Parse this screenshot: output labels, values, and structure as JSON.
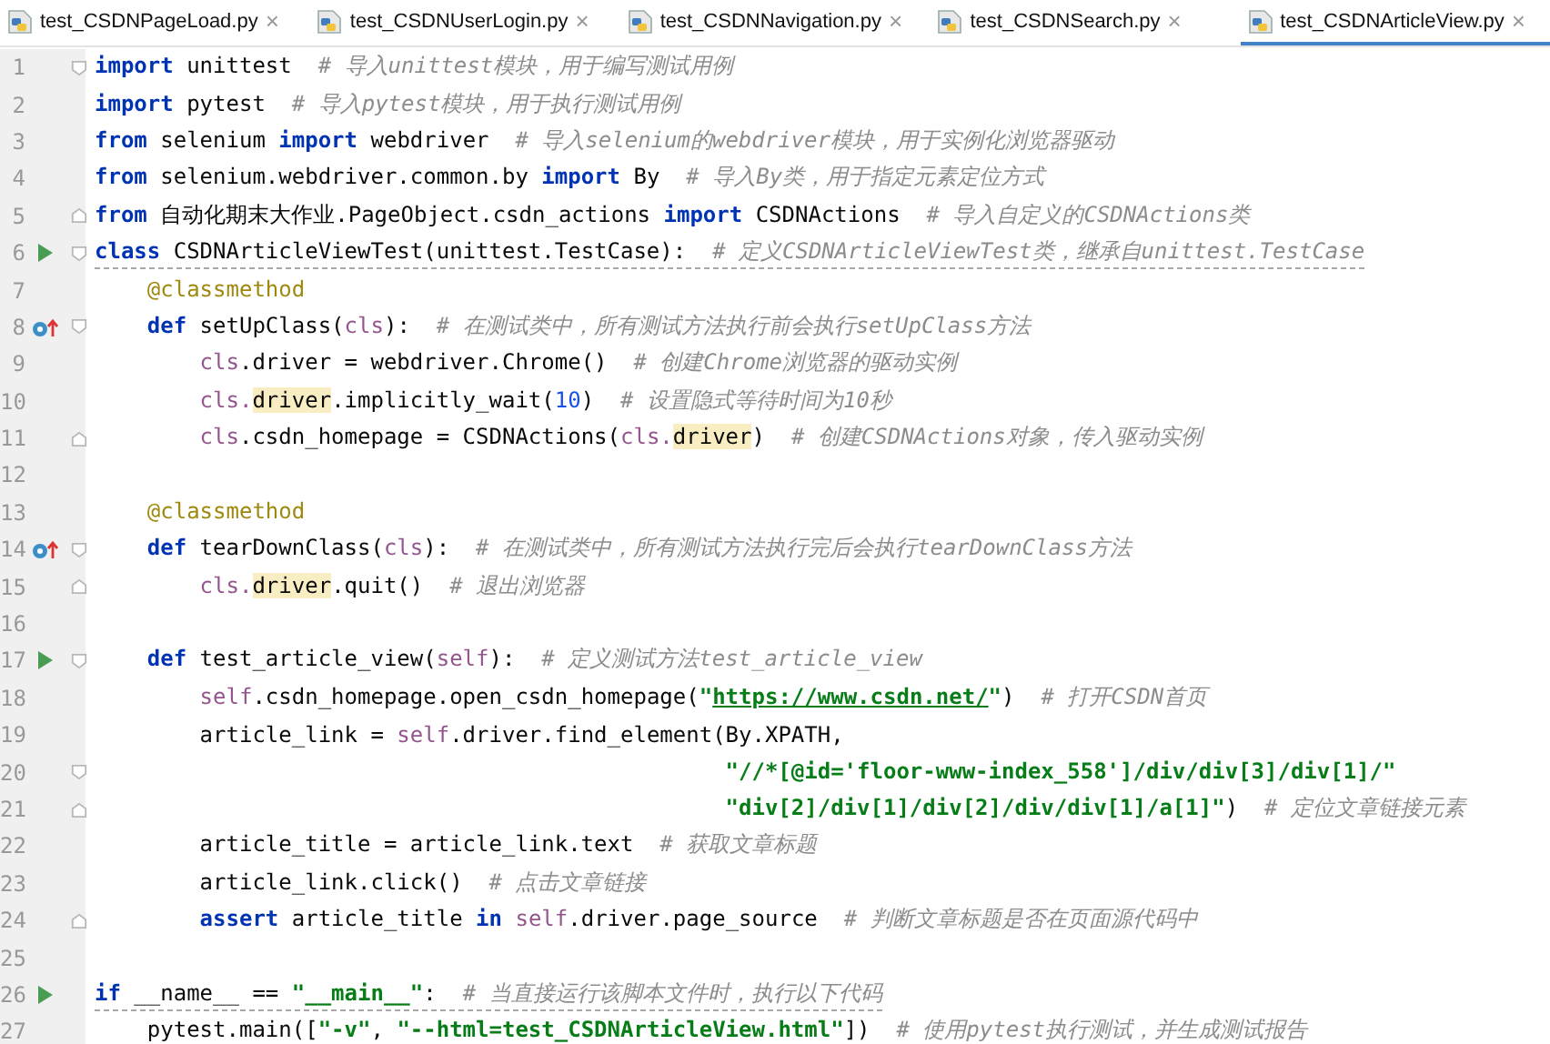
{
  "tabs": [
    {
      "label": "test_CSDNPageLoad.py",
      "close": "×",
      "selected": false
    },
    {
      "label": "test_CSDNUserLogin.py",
      "close": "×",
      "selected": false
    },
    {
      "label": "test_CSDNNavigation.py",
      "close": "×",
      "selected": false
    },
    {
      "label": "test_CSDNSearch.py",
      "close": "×",
      "selected": false
    },
    {
      "label": "test_CSDNArticleView.py",
      "close": "×",
      "selected": true
    }
  ],
  "lines": [
    {
      "number": "1",
      "fold": {
        "kind": "open"
      },
      "warning": false,
      "tokens": [
        {
          "kind": "kw",
          "text": "import"
        },
        {
          "kind": "p",
          "text": " unittest  "
        },
        {
          "kind": "c",
          "text": "# 导入unittest模块，用于编写测试用例"
        }
      ]
    },
    {
      "number": "2",
      "warning": false,
      "tokens": [
        {
          "kind": "kw",
          "text": "import"
        },
        {
          "kind": "p",
          "text": " pytest  "
        },
        {
          "kind": "c",
          "text": "# 导入pytest模块，用于执行测试用例"
        }
      ]
    },
    {
      "number": "3",
      "warning": false,
      "tokens": [
        {
          "kind": "kw",
          "text": "from"
        },
        {
          "kind": "p",
          "text": " selenium "
        },
        {
          "kind": "kw",
          "text": "import"
        },
        {
          "kind": "p",
          "text": " webdriver  "
        },
        {
          "kind": "c",
          "text": "# 导入selenium的webdriver模块，用于实例化浏览器驱动"
        }
      ]
    },
    {
      "number": "4",
      "warning": false,
      "tokens": [
        {
          "kind": "kw",
          "text": "from"
        },
        {
          "kind": "p",
          "text": " selenium.webdriver.common.by "
        },
        {
          "kind": "kw",
          "text": "import"
        },
        {
          "kind": "p",
          "text": " By  "
        },
        {
          "kind": "c",
          "text": "# 导入By类，用于指定元素定位方式"
        }
      ]
    },
    {
      "number": "5",
      "fold": {
        "kind": "close"
      },
      "warning": false,
      "tokens": [
        {
          "kind": "kw",
          "text": "from"
        },
        {
          "kind": "p",
          "text": " 自动化期末大作业.PageObject.csdn_actions "
        },
        {
          "kind": "kw",
          "text": "import"
        },
        {
          "kind": "p",
          "text": " CSDNActions  "
        },
        {
          "kind": "c",
          "text": "# 导入自定义的CSDNActions类"
        }
      ]
    },
    {
      "number": "6",
      "marker": {
        "kind": "run"
      },
      "fold": {
        "kind": "open"
      },
      "warning": true,
      "tokens": [
        {
          "kind": "kw",
          "text": "class"
        },
        {
          "kind": "p",
          "text": " CSDNArticleViewTest(unittest.TestCase):  "
        },
        {
          "kind": "c",
          "text": "# 定义CSDNArticleViewTest类，继承自unittest.TestCase"
        }
      ]
    },
    {
      "number": "7",
      "warning": false,
      "tokens": [
        {
          "kind": "d",
          "text": "    @classmethod"
        }
      ]
    },
    {
      "number": "8",
      "marker": {
        "kind": "override"
      },
      "fold": {
        "kind": "open"
      },
      "warning": false,
      "tokens": [
        {
          "kind": "kw",
          "text": "    def"
        },
        {
          "kind": "p",
          "text": " setUpClass("
        },
        {
          "kind": "s",
          "text": "cls"
        },
        {
          "kind": "p",
          "text": "):  "
        },
        {
          "kind": "c",
          "text": "# 在测试类中，所有测试方法执行前会执行setUpClass方法"
        }
      ]
    },
    {
      "number": "9",
      "warning": false,
      "tokens": [
        {
          "kind": "s",
          "text": "        cls"
        },
        {
          "kind": "p",
          "text": ".driver = webdriver.Chrome()  "
        },
        {
          "kind": "c",
          "text": "# 创建Chrome浏览器的驱动实例"
        }
      ]
    },
    {
      "number": "10",
      "warning": false,
      "tokens": [
        {
          "kind": "s",
          "text": "        cls."
        },
        {
          "kind": "h",
          "text": "driver"
        },
        {
          "kind": "p",
          "text": ".implicitly_wait("
        },
        {
          "kind": "n",
          "text": "10"
        },
        {
          "kind": "p",
          "text": ")  "
        },
        {
          "kind": "c",
          "text": "# 设置隐式等待时间为10秒"
        }
      ]
    },
    {
      "number": "11",
      "fold": {
        "kind": "close"
      },
      "warning": false,
      "tokens": [
        {
          "kind": "s",
          "text": "        cls"
        },
        {
          "kind": "p",
          "text": ".csdn_homepage = CSDNActions("
        },
        {
          "kind": "s",
          "text": "cls."
        },
        {
          "kind": "h",
          "text": "driver"
        },
        {
          "kind": "p",
          "text": ")  "
        },
        {
          "kind": "c",
          "text": "# 创建CSDNActions对象，传入驱动实例"
        }
      ]
    },
    {
      "number": "12",
      "warning": false
    },
    {
      "number": "13",
      "warning": false,
      "tokens": [
        {
          "kind": "d",
          "text": "    @classmethod"
        }
      ]
    },
    {
      "number": "14",
      "marker": {
        "kind": "override"
      },
      "fold": {
        "kind": "open"
      },
      "warning": false,
      "tokens": [
        {
          "kind": "kw",
          "text": "    def"
        },
        {
          "kind": "p",
          "text": " tearDownClass("
        },
        {
          "kind": "s",
          "text": "cls"
        },
        {
          "kind": "p",
          "text": "):  "
        },
        {
          "kind": "c",
          "text": "# 在测试类中，所有测试方法执行完后会执行tearDownClass方法"
        }
      ]
    },
    {
      "number": "15",
      "fold": {
        "kind": "close"
      },
      "warning": false,
      "tokens": [
        {
          "kind": "s",
          "text": "        cls."
        },
        {
          "kind": "h",
          "text": "driver"
        },
        {
          "kind": "p",
          "text": ".quit()  "
        },
        {
          "kind": "c",
          "text": "# 退出浏览器"
        }
      ]
    },
    {
      "number": "16",
      "warning": false
    },
    {
      "number": "17",
      "marker": {
        "kind": "run"
      },
      "fold": {
        "kind": "open"
      },
      "warning": false,
      "tokens": [
        {
          "kind": "kw",
          "text": "    def"
        },
        {
          "kind": "p",
          "text": " test_article_view("
        },
        {
          "kind": "s",
          "text": "self"
        },
        {
          "kind": "p",
          "text": "):  "
        },
        {
          "kind": "c",
          "text": "# 定义测试方法test_article_view"
        }
      ]
    },
    {
      "number": "18",
      "warning": false,
      "tokens": [
        {
          "kind": "s",
          "text": "        self"
        },
        {
          "kind": "p",
          "text": ".csdn_homepage.open_csdn_homepage("
        },
        {
          "kind": "str",
          "text": "\""
        },
        {
          "kind": "u",
          "text": "https://www.csdn.net/"
        },
        {
          "kind": "str",
          "text": "\""
        },
        {
          "kind": "p",
          "text": ")  "
        },
        {
          "kind": "c",
          "text": "# 打开CSDN首页"
        }
      ]
    },
    {
      "number": "19",
      "warning": false,
      "tokens": [
        {
          "kind": "p",
          "text": "        article_link = "
        },
        {
          "kind": "s",
          "text": "self"
        },
        {
          "kind": "p",
          "text": ".driver.find_element(By.XPATH,"
        }
      ]
    },
    {
      "number": "20",
      "fold": {
        "kind": "open"
      },
      "warning": false,
      "tokens": [
        {
          "kind": "str",
          "text": "                                                \"//*[@id='floor-www-index_558']/div/div[3]/div[1]/\""
        }
      ]
    },
    {
      "number": "21",
      "fold": {
        "kind": "close"
      },
      "warning": false,
      "tokens": [
        {
          "kind": "str",
          "text": "                                                \"div[2]/div[1]/div[2]/div/div[1]/a[1]\""
        },
        {
          "kind": "p",
          "text": ")  "
        },
        {
          "kind": "c",
          "text": "# 定位文章链接元素"
        }
      ]
    },
    {
      "number": "22",
      "warning": false,
      "tokens": [
        {
          "kind": "p",
          "text": "        article_title = article_link.text  "
        },
        {
          "kind": "c",
          "text": "# 获取文章标题"
        }
      ]
    },
    {
      "number": "23",
      "warning": false,
      "tokens": [
        {
          "kind": "p",
          "text": "        article_link.click()  "
        },
        {
          "kind": "c",
          "text": "# 点击文章链接"
        }
      ]
    },
    {
      "number": "24",
      "fold": {
        "kind": "close"
      },
      "warning": false,
      "tokens": [
        {
          "kind": "kw",
          "text": "        assert"
        },
        {
          "kind": "p",
          "text": " article_title "
        },
        {
          "kind": "kw",
          "text": "in "
        },
        {
          "kind": "s",
          "text": "self"
        },
        {
          "kind": "p",
          "text": ".driver.page_source  "
        },
        {
          "kind": "c",
          "text": "# 判断文章标题是否在页面源代码中"
        }
      ]
    },
    {
      "number": "25",
      "warning": false
    },
    {
      "number": "26",
      "marker": {
        "kind": "run"
      },
      "warning": true,
      "tokens": [
        {
          "kind": "kw",
          "text": "if"
        },
        {
          "kind": "p",
          "text": " __name__ == "
        },
        {
          "kind": "str",
          "text": "\"__main__\""
        },
        {
          "kind": "p",
          "text": ":  "
        },
        {
          "kind": "c",
          "text": "# 当直接运行该脚本文件时，执行以下代码"
        }
      ]
    },
    {
      "number": "27",
      "warning": false,
      "tokens": [
        {
          "kind": "p",
          "text": "    pytest.main(["
        },
        {
          "kind": "str",
          "text": "\"-v\""
        },
        {
          "kind": "p",
          "text": ", "
        },
        {
          "kind": "str",
          "text": "\"--html=test_CSDNArticleView.html\""
        },
        {
          "kind": "p",
          "text": "])  "
        },
        {
          "kind": "c",
          "text": "# 使用pytest执行测试，并生成测试报告"
        }
      ]
    }
  ]
}
